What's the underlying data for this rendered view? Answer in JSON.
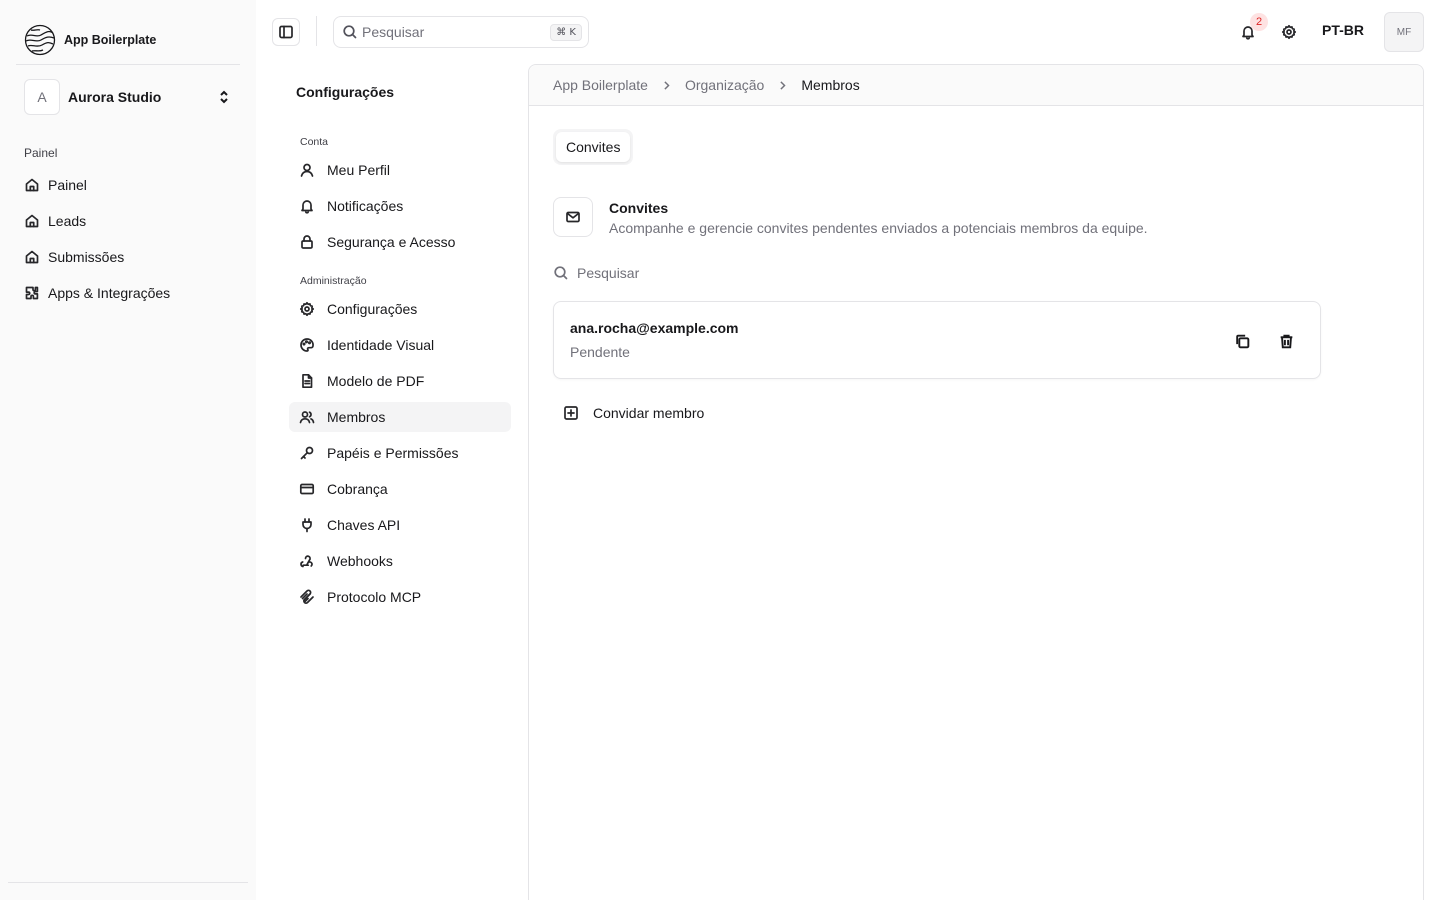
{
  "brand": {
    "name": "App Boilerplate",
    "logo_icon": "globe-logo-icon"
  },
  "org": {
    "initial": "A",
    "name": "Aurora Studio"
  },
  "sidebar": {
    "group_label": "Painel",
    "items": [
      {
        "label": "Painel",
        "icon": "home-icon"
      },
      {
        "label": "Leads",
        "icon": "home-icon"
      },
      {
        "label": "Submissões",
        "icon": "home-icon"
      },
      {
        "label": "Apps & Integrações",
        "icon": "puzzle-icon"
      }
    ]
  },
  "topbar": {
    "search_placeholder": "Pesquisar",
    "search_shortcut": "⌘ K",
    "notification_count": "2",
    "language": "PT-BR",
    "user_initials": "MF"
  },
  "settings": {
    "title": "Configurações",
    "account_label": "Conta",
    "account_items": [
      {
        "label": "Meu Perfil",
        "icon": "user-icon"
      },
      {
        "label": "Notificações",
        "icon": "bell-icon"
      },
      {
        "label": "Segurança e Acesso",
        "icon": "lock-icon"
      }
    ],
    "admin_label": "Administração",
    "admin_items": [
      {
        "label": "Configurações",
        "icon": "gear-icon"
      },
      {
        "label": "Identidade Visual",
        "icon": "palette-icon"
      },
      {
        "label": "Modelo de PDF",
        "icon": "file-text-icon"
      },
      {
        "label": "Membros",
        "icon": "users-icon",
        "active": true
      },
      {
        "label": "Papéis e Permissões",
        "icon": "key-icon"
      },
      {
        "label": "Cobrança",
        "icon": "credit-card-icon"
      },
      {
        "label": "Chaves API",
        "icon": "plug-icon"
      },
      {
        "label": "Webhooks",
        "icon": "webhook-icon"
      },
      {
        "label": "Protocolo MCP",
        "icon": "mcp-icon"
      }
    ]
  },
  "breadcrumb": [
    "App Boilerplate",
    "Organização",
    "Membros"
  ],
  "tabs": [
    {
      "label": "Convites",
      "active": true
    }
  ],
  "invites": {
    "title": "Convites",
    "description": "Acompanhe e gerencie convites pendentes enviados a potenciais membros da equipe.",
    "search_placeholder": "Pesquisar",
    "items": [
      {
        "email": "ana.rocha@example.com",
        "status": "Pendente"
      }
    ],
    "invite_button_label": "Convidar membro"
  },
  "colors": {
    "sidebar_bg": "#fafafa",
    "border": "#e4e4e7",
    "active_bg": "#f4f4f5",
    "badge_text": "#dc2626",
    "badge_bg": "#fee2e2"
  }
}
